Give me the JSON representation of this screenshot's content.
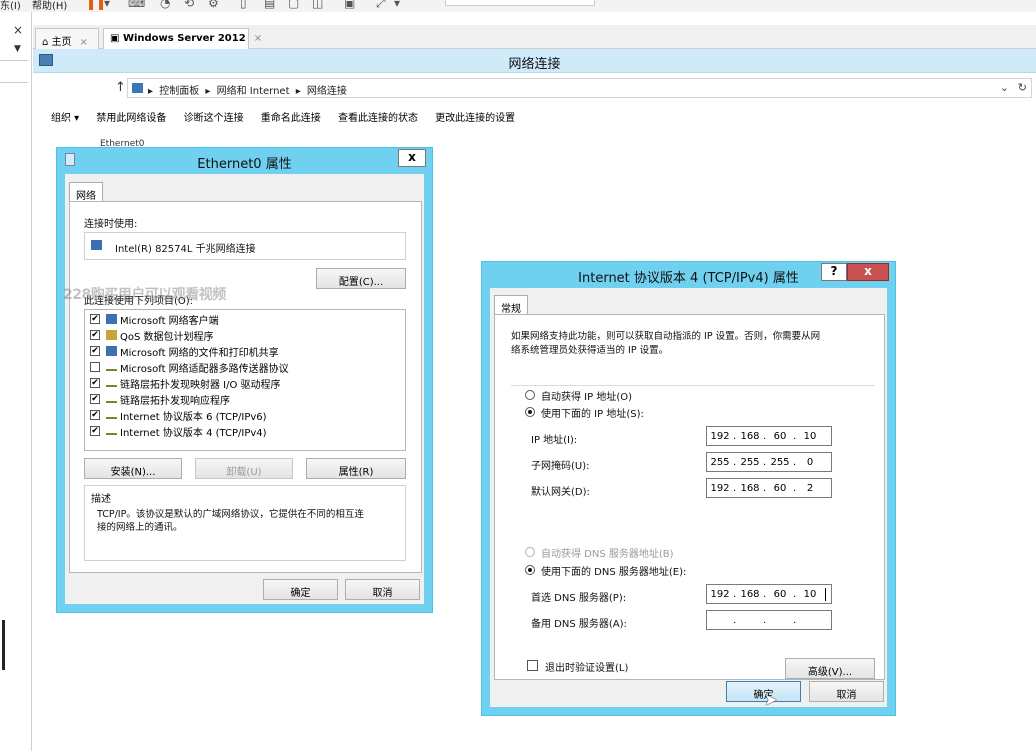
{
  "host": {
    "menu": [
      "东(I)",
      "帮助(H)"
    ],
    "tabs": [
      {
        "label": "主页",
        "close": "×"
      },
      {
        "label": "Windows Server 2012",
        "close": "×"
      }
    ],
    "left_close": "×",
    "left_dropdown": "▼"
  },
  "guest": {
    "window_title": "网络连接",
    "nav_up": "↑",
    "breadcrumb": [
      "控制面板",
      "网络和 Internet",
      "网络连接"
    ],
    "breadcrumb_sep": "▸",
    "commands": [
      "组织 ▾",
      "禁用此网络设备",
      "诊断这个连接",
      "重命名此连接",
      "查看此连接的状态",
      "更改此连接的设置"
    ],
    "adapter_label": "Ethernet0"
  },
  "eth_dialog": {
    "title": "Ethernet0 属性",
    "close": "x",
    "tab": "网络",
    "connect_using_label": "连接时使用:",
    "adapter_name": "Intel(R) 82574L 千兆网络连接",
    "configure_button": "配置(C)...",
    "items_label": "此连接使用下列项目(O):",
    "watermark": "228购买用户可以观看视频",
    "items": [
      {
        "checked": "✔",
        "icon": "net",
        "label": "Microsoft 网络客户端"
      },
      {
        "checked": "✔",
        "icon": "qos",
        "label": "QoS 数据包计划程序"
      },
      {
        "checked": "✔",
        "icon": "net",
        "label": "Microsoft 网络的文件和打印机共享"
      },
      {
        "checked": "",
        "icon": "proto",
        "label": "Microsoft 网络适配器多路传送器协议"
      },
      {
        "checked": "✔",
        "icon": "proto",
        "label": "链路层拓扑发现映射器 I/O 驱动程序"
      },
      {
        "checked": "✔",
        "icon": "proto",
        "label": "链路层拓扑发现响应程序"
      },
      {
        "checked": "✔",
        "icon": "proto",
        "label": "Internet 协议版本 6 (TCP/IPv6)"
      },
      {
        "checked": "✔",
        "icon": "proto",
        "label": "Internet 协议版本 4 (TCP/IPv4)"
      }
    ],
    "install_button": "安装(N)...",
    "uninstall_button": "卸载(U)",
    "properties_button": "属性(R)",
    "description_label": "描述",
    "description_line1": "TCP/IP。该协议是默认的广域网络协议，它提供在不同的相互连",
    "description_line2": "接的网络上的通讯。",
    "ok_button": "确定",
    "cancel_button": "取消"
  },
  "ipv4_dialog": {
    "title": "Internet 协议版本 4 (TCP/IPv4) 属性",
    "help": "?",
    "close": "x",
    "tab": "常规",
    "intro_line1": "如果网络支持此功能，则可以获取自动指派的 IP 设置。否则，你需要从网",
    "intro_line2": "络系统管理员处获得适当的 IP 设置。",
    "auto_ip_label": "自动获得 IP 地址(O)",
    "manual_ip_label": "使用下面的 IP 地址(S):",
    "ip_label": "IP 地址(I):",
    "ip_value": [
      "192",
      "168",
      "60",
      "10"
    ],
    "mask_label": "子网掩码(U):",
    "mask_value": [
      "255",
      "255",
      "255",
      "0"
    ],
    "gateway_label": "默认网关(D):",
    "gateway_value": [
      "192",
      "168",
      "60",
      "2"
    ],
    "auto_dns_label": "自动获得 DNS 服务器地址(B)",
    "manual_dns_label": "使用下面的 DNS 服务器地址(E):",
    "preferred_dns_label": "首选 DNS 服务器(P):",
    "preferred_dns_value": [
      "192",
      "168",
      "60",
      "10"
    ],
    "alternate_dns_label": "备用 DNS 服务器(A):",
    "alternate_dns_value": [
      "",
      "",
      "",
      ""
    ],
    "ip_dot": ".",
    "validate_label": "退出时验证设置(L)",
    "advanced_button": "高级(V)...",
    "ok_button": "确定",
    "cancel_button": "取消"
  },
  "colors": {
    "dialog_frame": "#6fd0f0",
    "title_bar": "#cfeaf8",
    "close_red": "#c75050"
  }
}
